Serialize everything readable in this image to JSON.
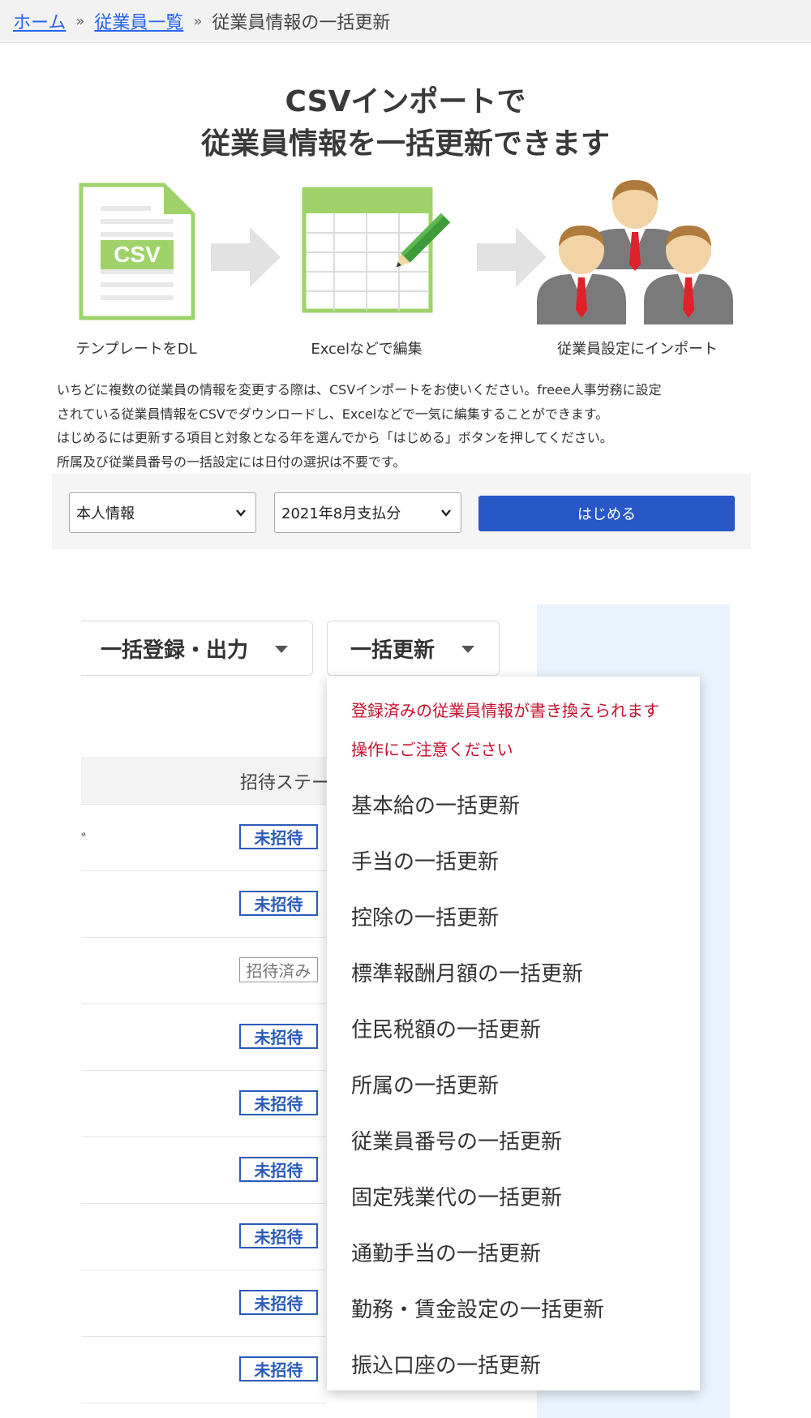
{
  "breadcrumb": {
    "home": "ホーム",
    "sep1": "»",
    "employees": "従業員一覧",
    "sep2": "»",
    "current": "従業員情報の一括更新"
  },
  "hero": {
    "title_line1": "CSVインポートで",
    "title_line2": "従業員情報を一括更新できます",
    "csv_text": "CSV",
    "steps": [
      "テンプレートをDL",
      "Excelなどで編集",
      "従業員設定にインポート"
    ]
  },
  "description": [
    "いちどに複数の従業員の情報を変更する際は、CSVインポートをお使いください。freee人事労務に設定",
    "されている従業員情報をCSVでダウンロードし、Excelなどで一気に編集することができます。",
    "はじめるには更新する項目と対象となる年を選んでから「はじめる」ボタンを押してください。",
    "所属及び従業員番号の一括設定には日付の選択は不要です。"
  ],
  "form": {
    "item_select": "本人情報",
    "period_select": "2021年8月支払分",
    "start_button": "はじめる"
  },
  "toolbar": {
    "bulk_register": "一括登録・出力",
    "bulk_update": "一括更新"
  },
  "table": {
    "status_header": "招待ステー",
    "row_mark": "ﾞ",
    "rows": [
      "未招待",
      "未招待",
      "招待済み",
      "未招待",
      "未招待",
      "未招待",
      "未招待",
      "未招待",
      "未招待"
    ]
  },
  "menu": {
    "warning_line1": "登録済みの従業員情報が書き換えられます",
    "warning_line2": "操作にご注意ください",
    "items": [
      "基本給の一括更新",
      "手当の一括更新",
      "控除の一括更新",
      "標準報酬月額の一括更新",
      "住民税額の一括更新",
      "所属の一括更新",
      "従業員番号の一括更新",
      "固定残業代の一括更新",
      "通勤手当の一括更新",
      "勤務・賃金設定の一括更新",
      "振込口座の一括更新"
    ]
  },
  "colors": {
    "link": "#2864f0",
    "primary_button": "#2858c8",
    "warning": "#c8102e",
    "csv_green": "#9fd36a",
    "badge_blue": "#2c5bb8"
  }
}
